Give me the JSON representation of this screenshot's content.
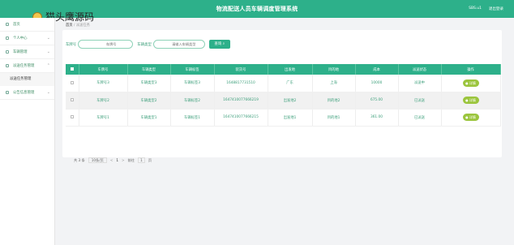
{
  "header": {
    "title": "物流配送人员车辆调度管理系统",
    "user": "SBS.u1",
    "logout": "退出登录"
  },
  "watermark": {
    "text": "猫头鹰源码"
  },
  "sidebar": {
    "items": [
      {
        "label": "首页"
      },
      {
        "label": "个人中心"
      },
      {
        "label": "车辆管理"
      },
      {
        "label": "派送任务管理"
      },
      {
        "label": "派送任务管理"
      },
      {
        "label": "公告信息管理"
      }
    ]
  },
  "breadcrumb": {
    "home": "首页",
    "sep": "/",
    "current": "派送任务"
  },
  "search": {
    "label1": "车牌号",
    "placeholder1": "车牌号",
    "label2": "车辆类型",
    "placeholder2": "请输入车辆类型",
    "button": "查询"
  },
  "table": {
    "headers": [
      "车牌号",
      "车辆类型",
      "车辆标签",
      "装货号",
      "出发地",
      "目的地",
      "成本",
      "派送状态",
      "操作"
    ],
    "rows": [
      [
        "车牌号3",
        "车辆类型3",
        "车辆标签3",
        "1648817731510",
        "广东",
        "上海",
        "10000",
        "派送中",
        "详情"
      ],
      [
        "车牌号2",
        "车辆类型2",
        "车辆标签2",
        "1647410077666219",
        "出发地2",
        "目的地2",
        "675.00",
        "已派送",
        "详情"
      ],
      [
        "车牌号1",
        "车辆类型1",
        "车辆标签1",
        "1647410077666215",
        "出发地1",
        "目的地1",
        "361.00",
        "已派送",
        "详情"
      ]
    ]
  },
  "pager": {
    "total": "共 3 条",
    "page_size": "10条/页",
    "prev": "<",
    "page": "1",
    "next": ">",
    "goto_label": "前往",
    "goto_value": "1",
    "page_unit": "页"
  }
}
